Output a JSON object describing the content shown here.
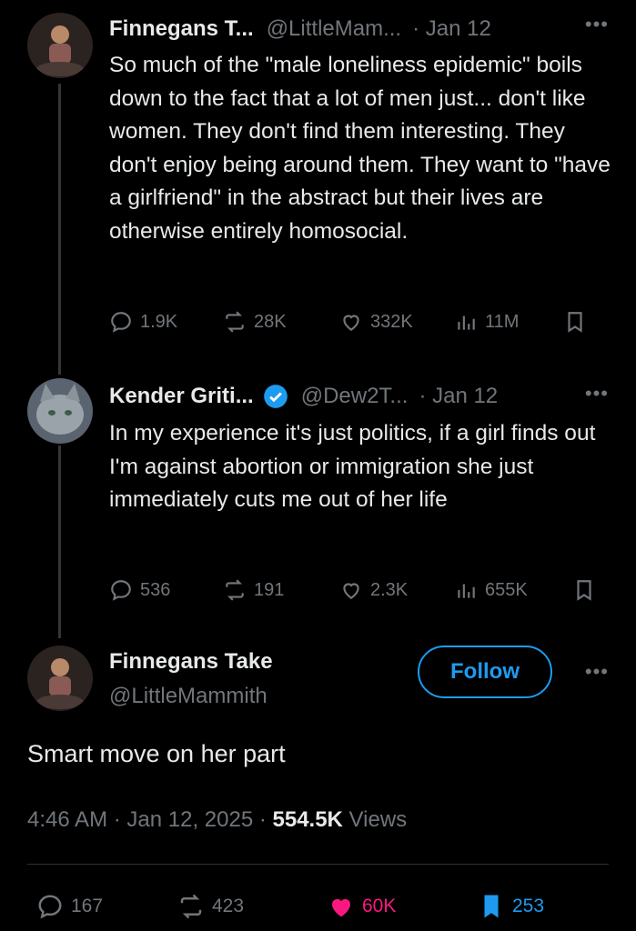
{
  "tweets": [
    {
      "display_name": "Finnegans T...",
      "handle": "@LittleMam...",
      "date": "· Jan 12",
      "text": "So much of the \"male loneliness epidemic\" boils down to the fact that a lot of men just... don't like women. They don't find them interesting. They don't enjoy being around them. They want to \"have a girlfriend\" in the abstract but their lives are otherwise entirely homosocial.",
      "replies": "1.9K",
      "reposts": "28K",
      "likes": "332K",
      "views": "11M"
    },
    {
      "display_name": "Kender Griti...",
      "handle": "@Dew2T...",
      "date": "· Jan 12",
      "verified": true,
      "text": "In my experience it's just politics, if a girl finds out I'm against abortion or immigration she just immediately cuts me out of her life",
      "replies": "536",
      "reposts": "191",
      "likes": "2.3K",
      "views": "655K"
    }
  ],
  "main_tweet": {
    "display_name": "Finnegans Take",
    "handle": "@LittleMammith",
    "follow_label": "Follow",
    "text": "Smart move on her part",
    "time": "4:46 AM · Jan 12, 2025 · ",
    "views_count": "554.5K",
    "views_label": " Views",
    "replies": "167",
    "reposts": "423",
    "likes": "60K",
    "bookmarks": "253"
  },
  "more_icon": "more-dots-icon",
  "colors": {
    "accent": "#1d9bf0",
    "like": "#f91880",
    "muted": "#71767b",
    "text": "#e7e9ea",
    "background": "#000000"
  }
}
